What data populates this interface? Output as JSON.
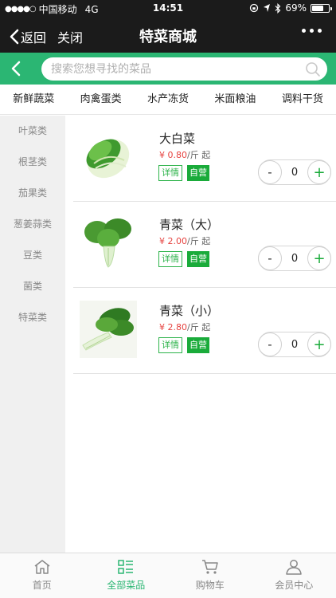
{
  "status_bar": {
    "signal_dots": "●●●●○",
    "carrier": "中国移动",
    "network": "4G",
    "time": "14:51",
    "battery": "69%",
    "battery_level": 0.69
  },
  "nav": {
    "back_label": "返回",
    "close_label": "关闭",
    "title": "特菜商城"
  },
  "search": {
    "placeholder": "搜索您想寻找的菜品"
  },
  "category_tabs": [
    "新鲜蔬菜",
    "肉禽蛋类",
    "水产冻货",
    "米面粮油",
    "调料干货"
  ],
  "sidebar": {
    "items": [
      "叶菜类",
      "根茎类",
      "茄果类",
      "葱姜蒜类",
      "豆类",
      "菌类",
      "特菜类"
    ]
  },
  "products": [
    {
      "name": "大白菜",
      "price": "¥ 0.80",
      "unit": "/斤 起",
      "detail_label": "详情",
      "badge": "自营",
      "qty_minus": "-",
      "qty": "0",
      "qty_plus": "+"
    },
    {
      "name": "青菜（大）",
      "price": "¥ 2.00",
      "unit": "/斤 起",
      "detail_label": "详情",
      "badge": "自营",
      "qty_minus": "-",
      "qty": "0",
      "qty_plus": "+"
    },
    {
      "name": "青菜（小）",
      "price": "¥ 2.80",
      "unit": "/斤 起",
      "detail_label": "详情",
      "badge": "自营",
      "qty_minus": "-",
      "qty": "0",
      "qty_plus": "+"
    }
  ],
  "tabbar": {
    "items": [
      "首页",
      "全部菜品",
      "购物车",
      "会员中心"
    ],
    "active": "全部菜品"
  },
  "colors": {
    "accent_green": "#2bb673",
    "price_red": "#e64340",
    "badge_green": "#1aab3a",
    "header_dark": "#1b1b1b"
  }
}
